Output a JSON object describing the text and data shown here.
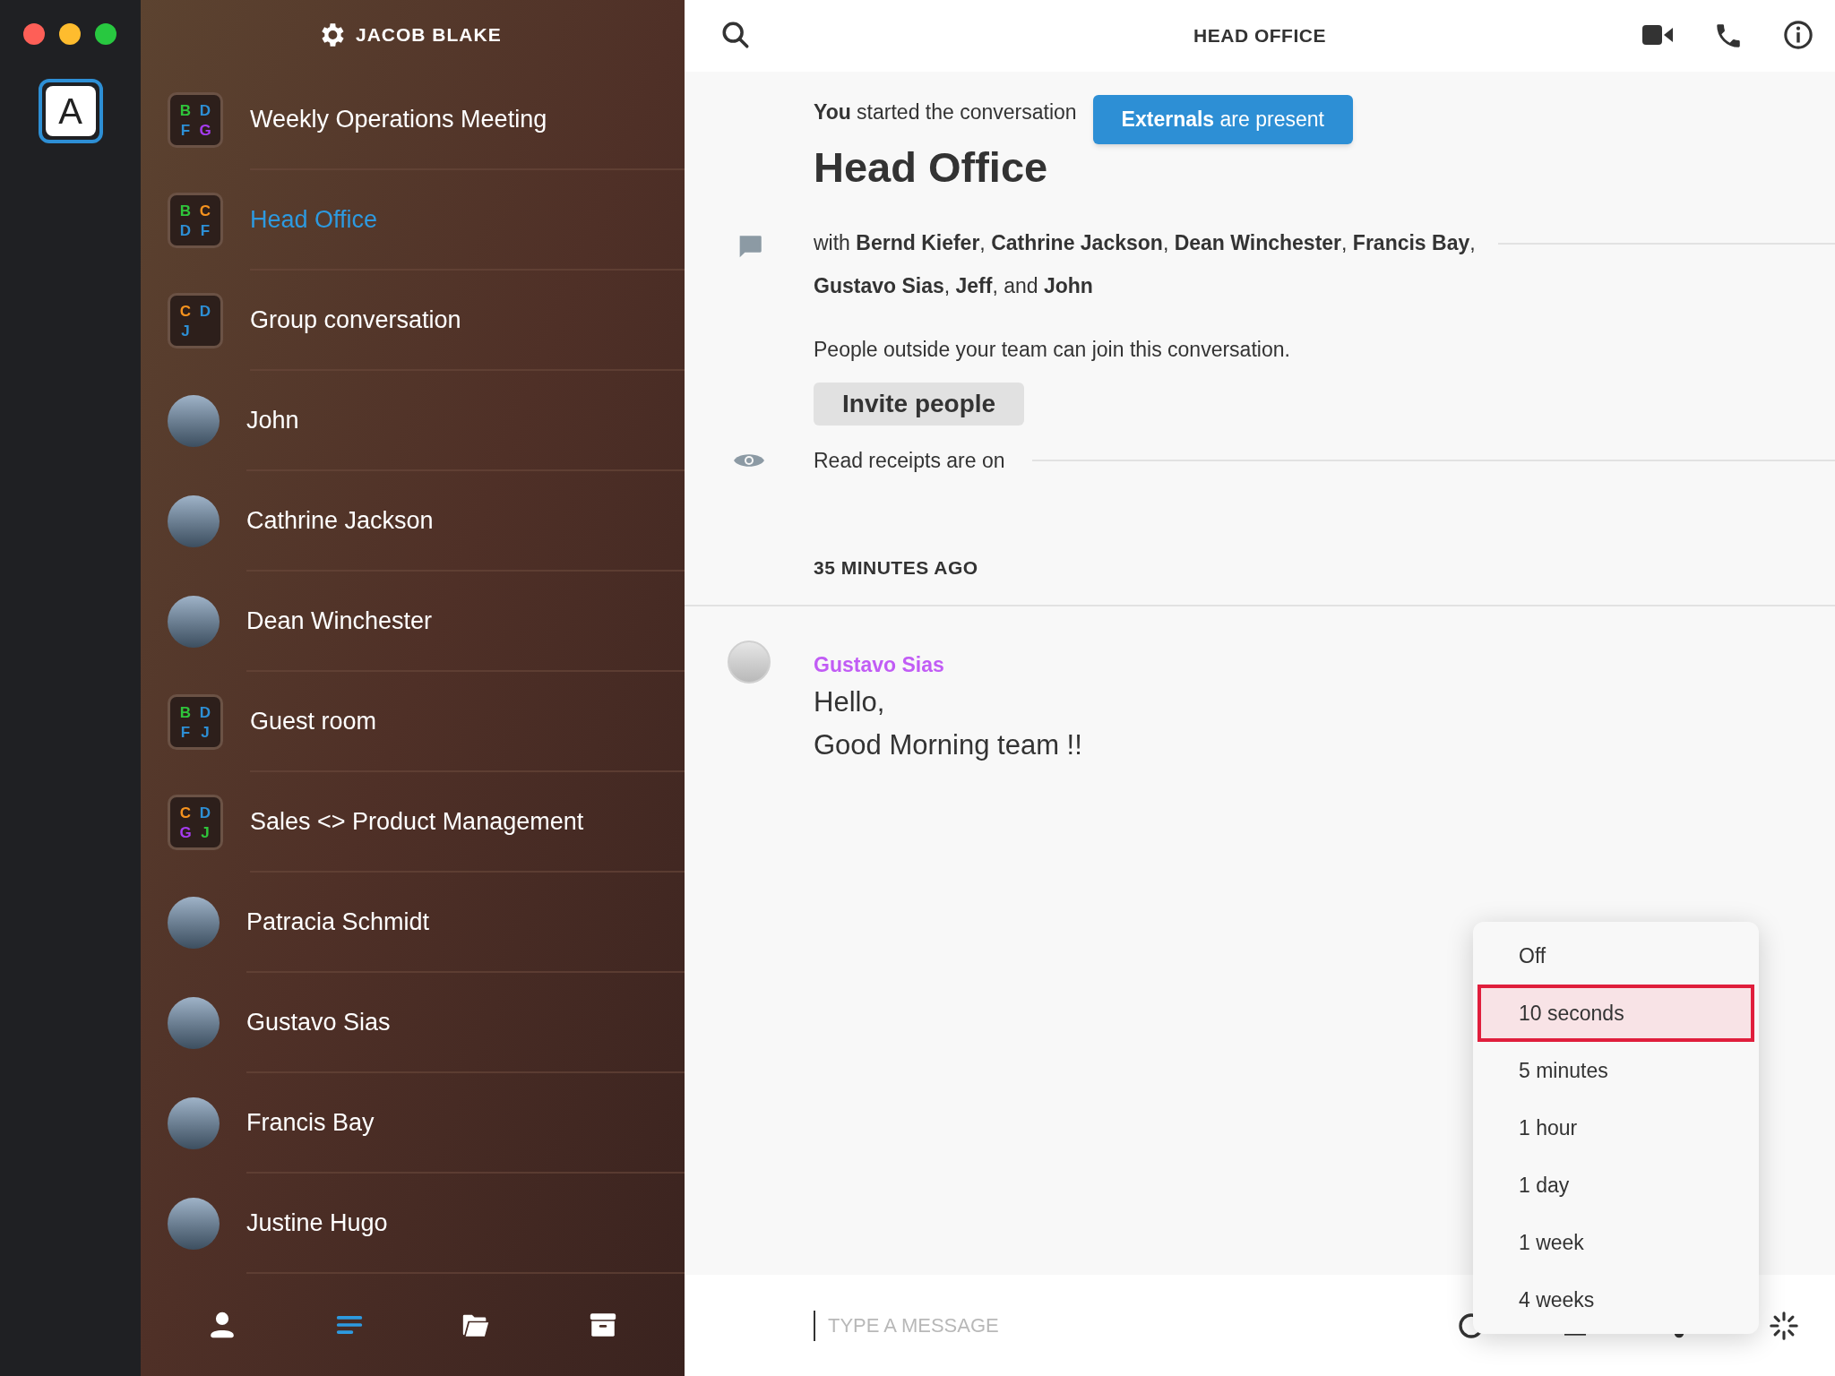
{
  "account": {
    "initial": "A"
  },
  "sidebar": {
    "title": "JACOB BLAKE",
    "conversations": [
      {
        "kind": "group",
        "name": "Weekly Operations Meeting",
        "selected": false,
        "initials": [
          {
            "letter": "B",
            "color": "#2fc53b"
          },
          {
            "letter": "D",
            "color": "#2d8fd5"
          },
          {
            "letter": "F",
            "color": "#2d8fd5"
          },
          {
            "letter": "G",
            "color": "#a63cf0"
          }
        ]
      },
      {
        "kind": "group",
        "name": "Head Office",
        "selected": true,
        "initials": [
          {
            "letter": "B",
            "color": "#2fc53b"
          },
          {
            "letter": "C",
            "color": "#f7931e"
          },
          {
            "letter": "D",
            "color": "#2d8fd5"
          },
          {
            "letter": "F",
            "color": "#2d8fd5"
          }
        ]
      },
      {
        "kind": "group",
        "name": "Group conversation",
        "selected": false,
        "initials": [
          {
            "letter": "C",
            "color": "#f7931e"
          },
          {
            "letter": "D",
            "color": "#2d8fd5"
          },
          {
            "letter": "J",
            "color": "#2d8fd5"
          }
        ]
      },
      {
        "kind": "person",
        "name": "John",
        "selected": false
      },
      {
        "kind": "person",
        "name": "Cathrine Jackson",
        "selected": false
      },
      {
        "kind": "person",
        "name": "Dean Winchester",
        "selected": false
      },
      {
        "kind": "group",
        "name": "Guest room",
        "selected": false,
        "initials": [
          {
            "letter": "B",
            "color": "#2fc53b"
          },
          {
            "letter": "D",
            "color": "#2d8fd5"
          },
          {
            "letter": "F",
            "color": "#2d8fd5"
          },
          {
            "letter": "J",
            "color": "#2d8fd5"
          }
        ]
      },
      {
        "kind": "group",
        "name": "Sales <> Product Management",
        "selected": false,
        "initials": [
          {
            "letter": "C",
            "color": "#f7931e"
          },
          {
            "letter": "D",
            "color": "#2d8fd5"
          },
          {
            "letter": "G",
            "color": "#a63cf0"
          },
          {
            "letter": "J",
            "color": "#2fc53b"
          }
        ]
      },
      {
        "kind": "person",
        "name": "Patracia Schmidt",
        "selected": false
      },
      {
        "kind": "person",
        "name": "Gustavo Sias",
        "selected": false
      },
      {
        "kind": "person",
        "name": "Francis Bay",
        "selected": false
      },
      {
        "kind": "person",
        "name": "Justine Hugo",
        "selected": false
      }
    ],
    "bottom_nav": [
      {
        "kind": "contacts",
        "selected": false
      },
      {
        "kind": "conversations",
        "selected": true
      },
      {
        "kind": "files",
        "selected": false
      },
      {
        "kind": "archive",
        "selected": false
      }
    ]
  },
  "conversation": {
    "title": "HEAD OFFICE",
    "started": "**You** started the conversation",
    "externals_badge": "**Externals** are present",
    "name": "Head Office",
    "participants": "with **Bernd Kiefer**, **Cathrine Jackson**, **Dean Winchester**, **Francis Bay**, **Gustavo Sias**, **Jeff**, and **John**",
    "notice": "People outside your team can join this conversation.",
    "invite_button": "Invite people",
    "read_receipts": "Read receipts are on",
    "timestamp": "35 MINUTES AGO",
    "messages": [
      {
        "sender": "Gustavo Sias",
        "lines": [
          "Hello,",
          "Good Morning team !!"
        ]
      }
    ],
    "composer": {
      "placeholder": "TYPE A MESSAGE"
    }
  },
  "timer_menu": {
    "options": [
      {
        "label": "Off",
        "selected": false
      },
      {
        "label": "10 seconds",
        "selected": true
      },
      {
        "label": "5 minutes",
        "selected": false
      },
      {
        "label": "1 hour",
        "selected": false
      },
      {
        "label": "1 day",
        "selected": false
      },
      {
        "label": "1 week",
        "selected": false
      },
      {
        "label": "4 weeks",
        "selected": false
      }
    ]
  }
}
